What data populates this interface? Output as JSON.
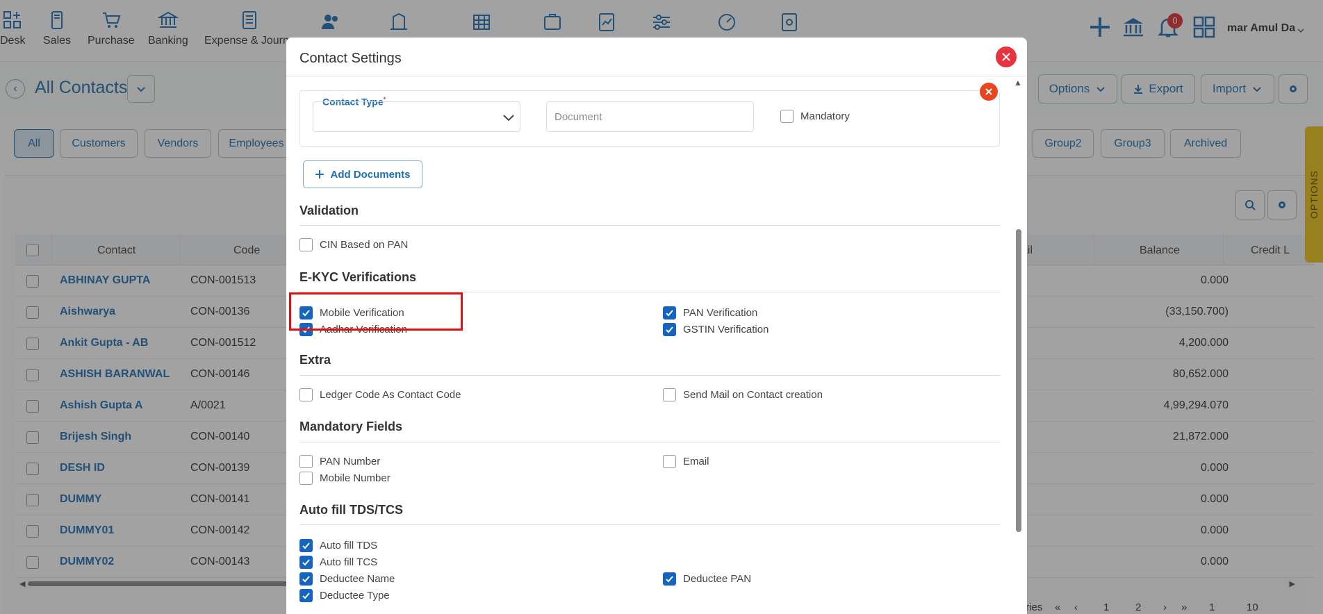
{
  "topnav": {
    "items": [
      {
        "label": "Desk",
        "icon": "desk-icon"
      },
      {
        "label": "Sales",
        "icon": "sales-icon"
      },
      {
        "label": "Purchase",
        "icon": "cart-icon"
      },
      {
        "label": "Banking",
        "icon": "bank-icon"
      },
      {
        "label": "Expense & Journa",
        "icon": "journal-icon"
      }
    ],
    "user_name": "mar Amul Da",
    "notification_count": "0"
  },
  "page": {
    "title": "All Contacts",
    "buttons": {
      "options": "Options",
      "export": "Export",
      "import": "Import"
    }
  },
  "filters": [
    "All",
    "Customers",
    "Vendors",
    "Employees",
    "Group2",
    "Group3",
    "Archived"
  ],
  "grid": {
    "columns": {
      "contact": "Contact",
      "code": "Code",
      "email": "ail",
      "balance": "Balance",
      "credit": "Credit L"
    },
    "rows": [
      {
        "name": "ABHINAY GUPTA",
        "code": "CON-001513",
        "balance": "0.000"
      },
      {
        "name": "Aishwarya",
        "code": "CON-00136",
        "balance": "(33,150.700)"
      },
      {
        "name": "Ankit Gupta - AB",
        "code": "CON-001512",
        "balance": "4,200.000"
      },
      {
        "name": "ASHISH BARANWAL",
        "code": "CON-00146",
        "balance": "80,652.000"
      },
      {
        "name": "Ashish Gupta A",
        "code": "A/0021",
        "balance": "4,99,294.070"
      },
      {
        "name": "Brijesh Singh",
        "code": "CON-00140",
        "balance": "21,872.000"
      },
      {
        "name": "DESH ID",
        "code": "CON-00139",
        "balance": "0.000"
      },
      {
        "name": "DUMMY",
        "code": "CON-00141",
        "balance": "0.000"
      },
      {
        "name": "DUMMY01",
        "code": "CON-00142",
        "balance": "0.000"
      },
      {
        "name": "DUMMY02",
        "code": "CON-00143",
        "balance": "0.000"
      }
    ]
  },
  "options_tab": "OPTIONS",
  "pager": {
    "label": "tries",
    "page_1": "1",
    "page_2": "2",
    "page_input": "1",
    "page_size": "10"
  },
  "modal": {
    "title": "Contact Settings",
    "documents": {
      "contact_type_label": "Contact Type",
      "required_mark": "*",
      "document_placeholder": "Document",
      "mandatory_label": "Mandatory",
      "add_documents_label": "Add Documents"
    },
    "sections": {
      "validation": "Validation",
      "ekyc": "E-KYC Verifications",
      "extra": "Extra",
      "mandatory": "Mandatory Fields",
      "autofill": "Auto fill TDS/TCS"
    },
    "checks": {
      "cin_pan": {
        "label": "CIN Based on PAN",
        "checked": false
      },
      "mobile_verification": {
        "label": "Mobile Verification",
        "checked": true
      },
      "aadhar_verification": {
        "label": "Aadhar Verification",
        "checked": true
      },
      "pan_verification": {
        "label": "PAN Verification",
        "checked": true
      },
      "gstin_verification": {
        "label": "GSTIN Verification",
        "checked": true
      },
      "ledger_code": {
        "label": "Ledger Code As Contact Code",
        "checked": false
      },
      "send_mail": {
        "label": "Send Mail on Contact creation",
        "checked": false
      },
      "pan_number": {
        "label": "PAN Number",
        "checked": false
      },
      "mobile_number": {
        "label": "Mobile Number",
        "checked": false
      },
      "email": {
        "label": "Email",
        "checked": false
      },
      "auto_tds": {
        "label": "Auto fill TDS",
        "checked": true
      },
      "auto_tcs": {
        "label": "Auto fill TCS",
        "checked": true
      },
      "deductee_name": {
        "label": "Deductee Name",
        "checked": true
      },
      "deductee_type": {
        "label": "Deductee Type",
        "checked": true
      },
      "deductee_pan": {
        "label": "Deductee PAN",
        "checked": true
      }
    }
  },
  "colors": {
    "accent": "#1f6fb2",
    "checkbox": "#1565c0",
    "close": "#e8333f",
    "highlight": "#e01010"
  }
}
